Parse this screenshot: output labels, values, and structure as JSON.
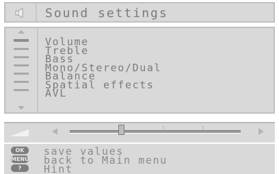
{
  "header": {
    "title": "Sound settings",
    "icon": "speaker-icon"
  },
  "menu": {
    "items": [
      {
        "label": "Volume"
      },
      {
        "label": "Treble"
      },
      {
        "label": "Bass"
      },
      {
        "label": "Mono/Stereo/Dual"
      },
      {
        "label": "Balance"
      },
      {
        "label": "Spatial effects"
      },
      {
        "label": "AVL"
      }
    ],
    "selected_index": 0
  },
  "slider": {
    "name": "volume-slider",
    "level": 0.3
  },
  "footer": {
    "rows": [
      {
        "key": "OK",
        "label": "save values"
      },
      {
        "key": "MENU",
        "label": "back to Main menu"
      },
      {
        "key": "?",
        "label": "Hint"
      }
    ]
  },
  "colors": {
    "panel": "#d9d9d9",
    "text": "#7a7a7a",
    "border": "#c0c0c0"
  }
}
